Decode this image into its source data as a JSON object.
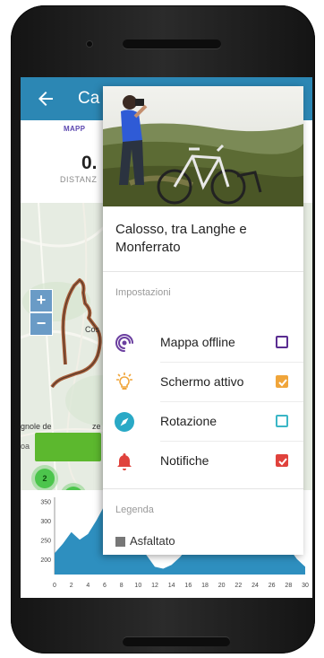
{
  "app": {
    "title": "Ca",
    "brand": "MAPP",
    "stat_value": "0.",
    "stat_label": "DISTANZ"
  },
  "map": {
    "zoom_in": "+",
    "zoom_out": "−",
    "labels": [
      "Cos",
      "gnole de",
      "ze",
      "oa"
    ],
    "clusters": [
      "2",
      "1"
    ]
  },
  "chart_data": {
    "type": "area",
    "x_ticks": [
      "0",
      "2",
      "4",
      "6",
      "8",
      "10",
      "12",
      "14",
      "16",
      "18",
      "20",
      "22",
      "24",
      "26",
      "28",
      "30"
    ],
    "y_ticks": [
      "350",
      "300",
      "250",
      "200"
    ],
    "xlim": [
      0,
      30
    ],
    "ylim": [
      160,
      360
    ],
    "x": [
      0,
      1,
      2,
      3,
      4,
      5,
      6,
      7,
      8,
      9,
      10,
      11,
      12,
      13,
      14,
      15,
      16,
      17,
      18,
      19,
      20,
      21,
      22,
      23,
      24,
      25,
      26,
      27,
      28,
      29,
      30
    ],
    "y": [
      215,
      240,
      270,
      250,
      265,
      300,
      340,
      335,
      280,
      255,
      235,
      210,
      180,
      175,
      185,
      205,
      230,
      240,
      235,
      230,
      240,
      245,
      230,
      220,
      230,
      240,
      250,
      245,
      230,
      200,
      180
    ],
    "color": "#2e8fbf"
  },
  "drawer": {
    "title": "Calosso, tra Langhe e Monferrato",
    "settings_header": "Impostazioni",
    "settings": [
      {
        "label": "Mappa offline",
        "icon": "offline-map-icon",
        "icon_color": "#6b3fa0",
        "checked": false,
        "color": "#5a2d91"
      },
      {
        "label": "Schermo attivo",
        "icon": "lightbulb-icon",
        "icon_color": "#f0a53a",
        "checked": true,
        "color": "#f0a53a"
      },
      {
        "label": "Rotazione",
        "icon": "compass-icon",
        "icon_color": "#2aa9c6",
        "checked": false,
        "color": "#3bb6c6"
      },
      {
        "label": "Notifiche",
        "icon": "bell-icon",
        "icon_color": "#e0423c",
        "checked": true,
        "color": "#e0423c"
      }
    ],
    "legend_header": "Legenda",
    "legend_items": [
      {
        "label": "Asfaltato",
        "color": "#777777"
      }
    ]
  }
}
